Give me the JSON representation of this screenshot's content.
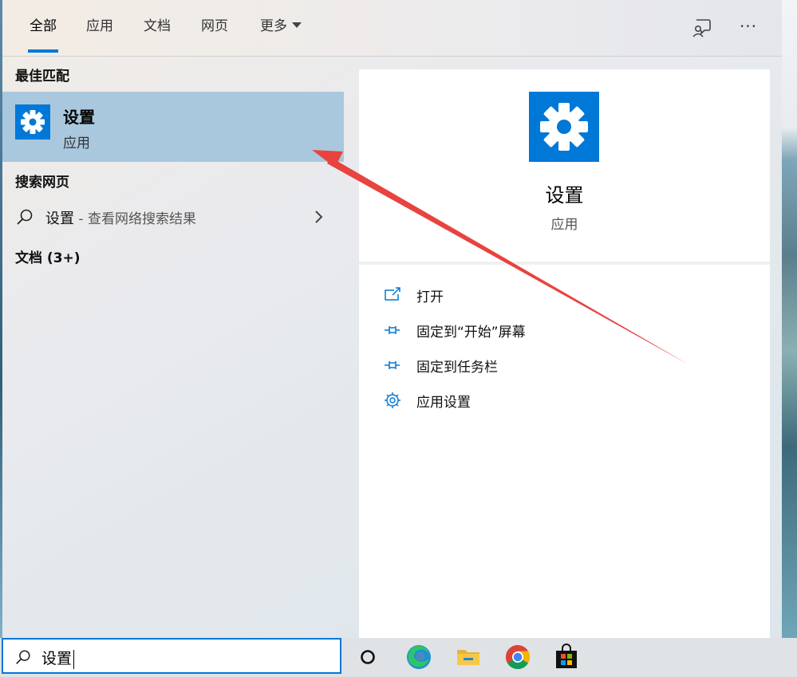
{
  "tabs": [
    {
      "label": "全部"
    },
    {
      "label": "应用"
    },
    {
      "label": "文档"
    },
    {
      "label": "网页"
    },
    {
      "label": "更多"
    }
  ],
  "results": {
    "best_match_header": "最佳匹配",
    "best_match": {
      "title": "设置",
      "subtitle": "应用",
      "icon": "gear-icon"
    },
    "web_header": "搜索网页",
    "web_item": {
      "query": "设置",
      "suffix": " - 查看网络搜索结果"
    },
    "docs_header": "文档 (3+)"
  },
  "detail": {
    "title": "设置",
    "subtitle": "应用",
    "actions": [
      {
        "label": "打开",
        "icon": "open-icon"
      },
      {
        "label": "固定到“开始”屏幕",
        "icon": "pin-icon"
      },
      {
        "label": "固定到任务栏",
        "icon": "pin-icon"
      },
      {
        "label": "应用设置",
        "icon": "gear-icon"
      }
    ]
  },
  "taskbar": {
    "search_value": "设置",
    "apps": [
      {
        "name": "Cortana",
        "icon": "cortana-circle-icon"
      },
      {
        "name": "Microsoft Edge",
        "icon": "edge-icon"
      },
      {
        "name": "File Explorer",
        "icon": "folder-icon"
      },
      {
        "name": "Google Chrome",
        "icon": "chrome-icon"
      },
      {
        "name": "Microsoft Store",
        "icon": "store-icon"
      }
    ]
  },
  "colors": {
    "accent": "#0078d7",
    "selection": "#a9c8de",
    "annotation_arrow": "#e8433f"
  }
}
